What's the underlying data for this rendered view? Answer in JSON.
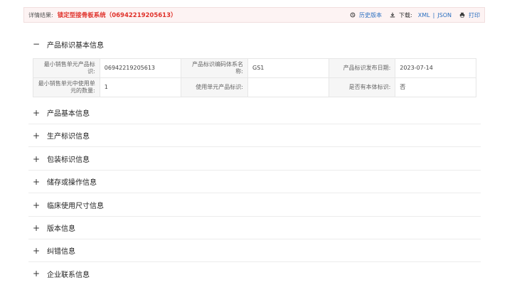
{
  "header": {
    "label": "详情结果:",
    "title": "锁定型接骨板系统（06942219205613）",
    "history": "历史版本",
    "download": "下载:",
    "xml": "XML",
    "separator": "|",
    "json": "JSON",
    "print": "打印"
  },
  "section_open": {
    "mark": "−",
    "title": "产品标识基本信息",
    "rows": [
      [
        {
          "k": "最小销售单元产品标识:",
          "v": "06942219205613"
        },
        {
          "k": "产品标识编码体系名称:",
          "v": "GS1"
        },
        {
          "k": "产品标识发布日期:",
          "v": "2023-07-14"
        }
      ],
      [
        {
          "k": "最小销售单元中使用单元的数量:",
          "v": "1"
        },
        {
          "k": "使用单元产品标识:",
          "v": ""
        },
        {
          "k": "是否有本体标识:",
          "v": "否"
        }
      ]
    ]
  },
  "sections": [
    {
      "mark": "+",
      "title": "产品基本信息"
    },
    {
      "mark": "+",
      "title": "生产标识信息"
    },
    {
      "mark": "+",
      "title": "包装标识信息"
    },
    {
      "mark": "+",
      "title": "储存或操作信息"
    },
    {
      "mark": "+",
      "title": "临床使用尺寸信息"
    },
    {
      "mark": "+",
      "title": "版本信息"
    },
    {
      "mark": "+",
      "title": "纠错信息"
    },
    {
      "mark": "+",
      "title": "企业联系信息"
    }
  ]
}
